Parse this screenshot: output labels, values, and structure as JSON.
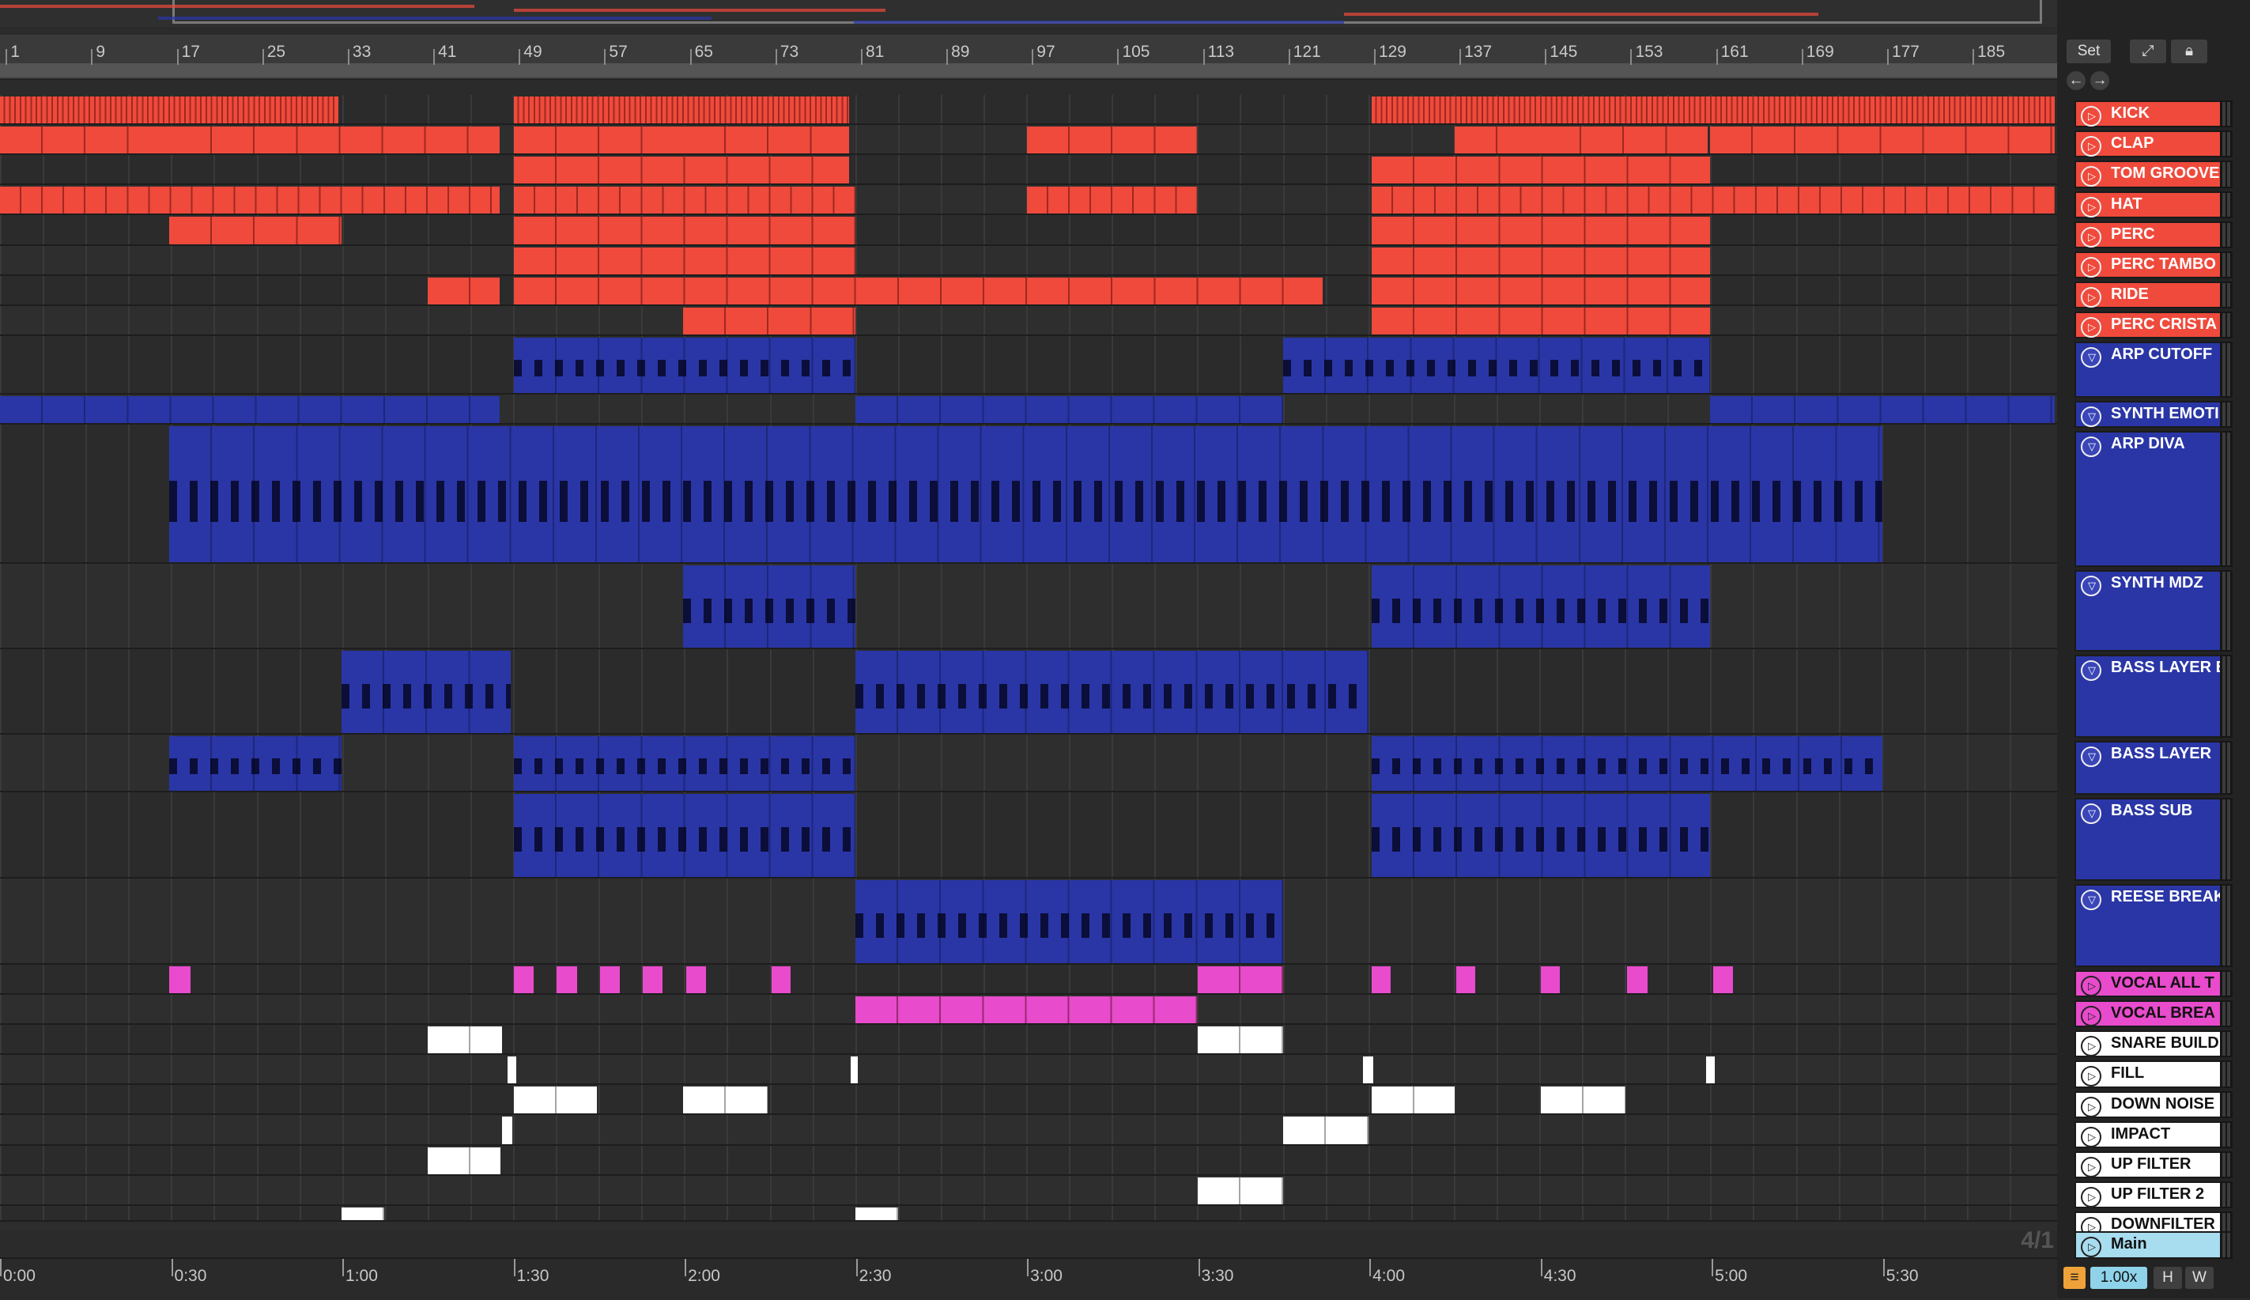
{
  "ruler": {
    "bars": [
      "1",
      "9",
      "17",
      "25",
      "33",
      "41",
      "49",
      "57",
      "65",
      "73",
      "81",
      "89",
      "97",
      "105",
      "113",
      "121",
      "129",
      "137",
      "145",
      "153",
      "161",
      "169",
      "177",
      "185"
    ]
  },
  "timeline": {
    "times": [
      "0:00",
      "0:30",
      "1:00",
      "1:30",
      "2:00",
      "2:30",
      "3:00",
      "3:30",
      "4:00",
      "4:30",
      "5:00",
      "5:30"
    ],
    "time_signature": "4/1"
  },
  "controls": {
    "set_label": "Set",
    "fullscreen_icon": "expand-icon",
    "lock_icon": "lock-icon",
    "back_icon": "arrow-left-icon",
    "forward_icon": "arrow-right-icon",
    "zoom": "1.00x",
    "h_label": "H",
    "w_label": "W"
  },
  "colors": {
    "drums": "#ef4a3c",
    "synth": "#2a36a6",
    "vocal": "#e84bcc",
    "fx": "#ffffff",
    "main": "#a8dcef",
    "background": "#2d2d2d"
  },
  "tracks": [
    {
      "name": "KICK",
      "color": "#ef4a3c",
      "clips": [
        [
          0,
          236
        ],
        [
          358,
          592
        ],
        [
          956,
          1432
        ]
      ],
      "style": "dense"
    },
    {
      "name": "CLAP",
      "color": "#ef4a3c",
      "clips": [
        [
          0,
          118
        ],
        [
          118,
          348
        ],
        [
          358,
          476
        ],
        [
          476,
          592
        ],
        [
          716,
          834
        ],
        [
          1014,
          1072
        ],
        [
          1072,
          1190
        ],
        [
          1192,
          1432
        ]
      ]
    },
    {
      "name": "TOM GROOVE",
      "color": "#ef4a3c",
      "clips": [
        [
          358,
          592
        ],
        [
          956,
          1192
        ]
      ]
    },
    {
      "name": "HAT",
      "color": "#ef4a3c",
      "clips": [
        [
          0,
          348
        ],
        [
          358,
          596
        ],
        [
          716,
          834
        ],
        [
          956,
          1432
        ]
      ],
      "style": "dense2"
    },
    {
      "name": "PERC",
      "color": "#ef4a3c",
      "clips": [
        [
          118,
          238
        ],
        [
          358,
          596
        ],
        [
          956,
          1192
        ]
      ]
    },
    {
      "name": "PERC TAMBO",
      "color": "#ef4a3c",
      "clips": [
        [
          358,
          596
        ],
        [
          956,
          1192
        ]
      ]
    },
    {
      "name": "RIDE",
      "color": "#ef4a3c",
      "clips": [
        [
          298,
          348
        ],
        [
          358,
          922
        ],
        [
          956,
          1192
        ]
      ]
    },
    {
      "name": "PERC CRISTA",
      "color": "#ef4a3c",
      "clips": [
        [
          476,
          596
        ],
        [
          956,
          1192
        ]
      ]
    },
    {
      "name": "ARP CUTOFF",
      "color": "#2a36a6",
      "clips": [
        [
          358,
          596
        ],
        [
          894,
          1192
        ]
      ]
    },
    {
      "name": "SYNTH EMOTI",
      "color": "#2a36a6",
      "clips": [
        [
          0,
          348
        ],
        [
          596,
          894
        ],
        [
          1192,
          1432
        ]
      ]
    },
    {
      "name": "ARP DIVA",
      "color": "#2a36a6",
      "clips": [
        [
          118,
          1312
        ]
      ]
    },
    {
      "name": "SYNTH MDZ",
      "color": "#2a36a6",
      "clips": [
        [
          476,
          596
        ],
        [
          956,
          1192
        ]
      ]
    },
    {
      "name": "BASS LAYER B",
      "color": "#2a36a6",
      "clips": [
        [
          238,
          356
        ],
        [
          596,
          954
        ]
      ]
    },
    {
      "name": "BASS LAYER",
      "color": "#2a36a6",
      "clips": [
        [
          118,
          238
        ],
        [
          358,
          596
        ],
        [
          956,
          1312
        ]
      ]
    },
    {
      "name": "BASS SUB",
      "color": "#2a36a6",
      "clips": [
        [
          358,
          596
        ],
        [
          956,
          1192
        ]
      ]
    },
    {
      "name": "REESE BREAK",
      "color": "#2a36a6",
      "clips": [
        [
          596,
          894
        ]
      ]
    },
    {
      "name": "VOCAL ALL T",
      "color": "#e84bcc",
      "clips": [
        [
          118,
          133
        ],
        [
          358,
          372
        ],
        [
          388,
          402
        ],
        [
          418,
          432
        ],
        [
          448,
          462
        ],
        [
          478,
          492
        ],
        [
          538,
          551
        ],
        [
          835,
          894
        ],
        [
          956,
          969
        ],
        [
          1015,
          1028
        ],
        [
          1074,
          1087
        ],
        [
          1134,
          1148
        ],
        [
          1194,
          1208
        ]
      ]
    },
    {
      "name": "VOCAL BREA",
      "color": "#e84bcc",
      "clips": [
        [
          596,
          834
        ]
      ]
    },
    {
      "name": "SNARE BUILD",
      "color": "#ffffff",
      "clips": [
        [
          298,
          350
        ],
        [
          835,
          894
        ]
      ]
    },
    {
      "name": "FILL",
      "color": "#ffffff",
      "clips": [
        [
          354,
          360
        ],
        [
          593,
          598
        ],
        [
          950,
          957
        ],
        [
          1189,
          1195
        ]
      ]
    },
    {
      "name": "DOWN NOISE",
      "color": "#ffffff",
      "clips": [
        [
          358,
          416
        ],
        [
          476,
          535
        ],
        [
          956,
          1014
        ],
        [
          1074,
          1133
        ]
      ]
    },
    {
      "name": "IMPACT",
      "color": "#ffffff",
      "clips": [
        [
          350,
          357
        ],
        [
          894,
          954
        ]
      ]
    },
    {
      "name": "UP FILTER",
      "color": "#ffffff",
      "clips": [
        [
          298,
          349
        ]
      ]
    },
    {
      "name": "UP FILTER 2",
      "color": "#ffffff",
      "clips": [
        [
          835,
          894
        ]
      ]
    },
    {
      "name": "DOWNFILTER",
      "color": "#ffffff",
      "clips": [
        [
          238,
          268
        ],
        [
          596,
          626
        ]
      ]
    },
    {
      "name": "Main",
      "color": "#a8dcef",
      "clips": []
    }
  ]
}
